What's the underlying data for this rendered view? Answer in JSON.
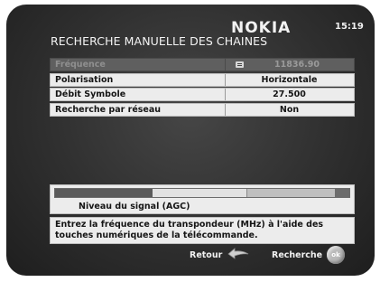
{
  "header": {
    "brand": "NOKIA",
    "clock": "15:19",
    "title": "RECHERCHE MANUELLE DES CHAINES"
  },
  "settings": [
    {
      "label": "Fréquence",
      "value": "11836.90",
      "active": true
    },
    {
      "label": "Polarisation",
      "value": "Horizontale"
    },
    {
      "label": "Débit Symbole",
      "value": "27.500"
    },
    {
      "label": "Recherche par réseau",
      "value": "Non"
    }
  ],
  "signal": {
    "label": "Niveau du signal (AGC)",
    "level": 0.33
  },
  "help": {
    "line1": "Entrez la fréquence du transpondeur (MHz) à l'aide des",
    "line2": "touches numériques de la télécommande."
  },
  "footer": {
    "back_label": "Retour",
    "search_label": "Recherche",
    "ok_label": "ok"
  },
  "icons": {
    "stepper": "updown-stepper-icon",
    "back": "back-arrow-icon",
    "ok": "ok-button-icon"
  }
}
